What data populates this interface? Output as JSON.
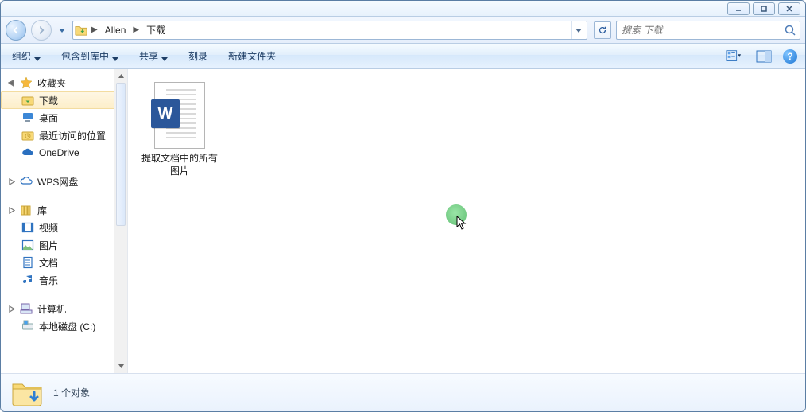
{
  "breadcrumb": {
    "seg1": "Allen",
    "seg2": "下载"
  },
  "search": {
    "placeholder": "搜索 下载"
  },
  "toolbar": {
    "organize": "组织",
    "include": "包含到库中",
    "share": "共享",
    "burn": "刻录",
    "newfolder": "新建文件夹"
  },
  "sidebar": {
    "favorites": "收藏夹",
    "downloads": "下载",
    "desktop": "桌面",
    "recent": "最近访问的位置",
    "onedrive": "OneDrive",
    "wps": "WPS网盘",
    "libraries": "库",
    "videos": "视频",
    "pictures": "图片",
    "documents": "文档",
    "music": "音乐",
    "computer": "计算机",
    "cdrive": "本地磁盘 (C:)"
  },
  "file": {
    "name": "提取文档中的所有图片",
    "badge": "W"
  },
  "status": {
    "text": "1 个对象"
  }
}
